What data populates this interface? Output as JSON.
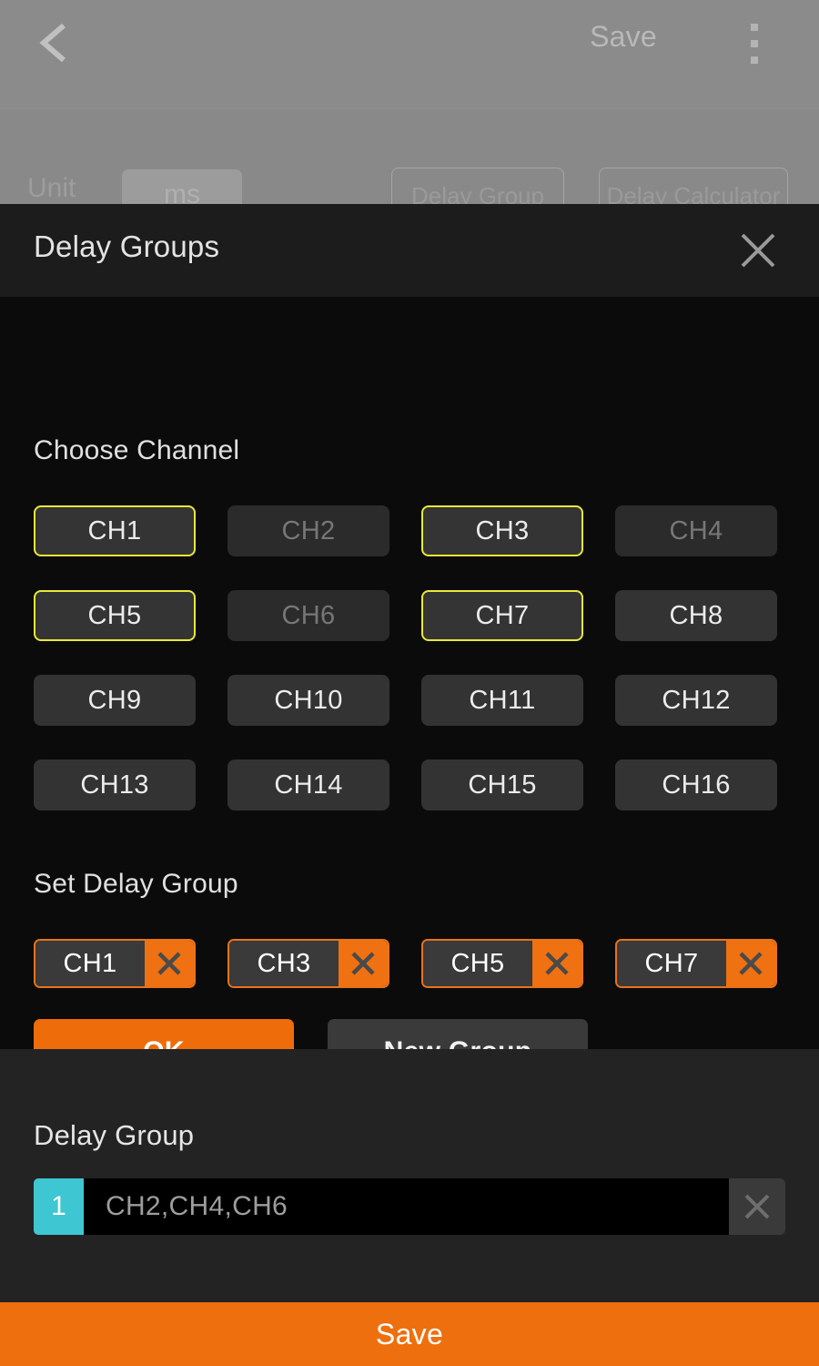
{
  "background_app": {
    "back_icon": "chevron-left-icon",
    "save_label": "Save",
    "overflow_icon": "more-vertical-icon",
    "unit_label": "Unit",
    "unit_value": "ms",
    "tabs": [
      {
        "label": "Delay Group"
      },
      {
        "label": "Delay Calculator"
      }
    ]
  },
  "modal": {
    "title": "Delay Groups",
    "close_icon": "close-icon",
    "choose_channel_label": "Choose Channel",
    "channels": [
      {
        "label": "CH1",
        "state": "selected"
      },
      {
        "label": "CH2",
        "state": "dimmed"
      },
      {
        "label": "CH3",
        "state": "selected"
      },
      {
        "label": "CH4",
        "state": "dimmed"
      },
      {
        "label": "CH5",
        "state": "selected"
      },
      {
        "label": "CH6",
        "state": "dimmed"
      },
      {
        "label": "CH7",
        "state": "selected"
      },
      {
        "label": "CH8",
        "state": "normal"
      },
      {
        "label": "CH9",
        "state": "normal"
      },
      {
        "label": "CH10",
        "state": "normal"
      },
      {
        "label": "CH11",
        "state": "normal"
      },
      {
        "label": "CH12",
        "state": "normal"
      },
      {
        "label": "CH13",
        "state": "normal"
      },
      {
        "label": "CH14",
        "state": "normal"
      },
      {
        "label": "CH15",
        "state": "normal"
      },
      {
        "label": "CH16",
        "state": "normal"
      }
    ],
    "set_delay_group_label": "Set Delay Group",
    "chips": [
      {
        "label": "CH1",
        "remove_icon": "close-icon"
      },
      {
        "label": "CH3",
        "remove_icon": "close-icon"
      },
      {
        "label": "CH5",
        "remove_icon": "close-icon"
      },
      {
        "label": "CH7",
        "remove_icon": "close-icon"
      }
    ],
    "ok_label": "OK",
    "new_group_label": "New Group"
  },
  "delay_group_panel": {
    "title": "Delay Group",
    "rows": [
      {
        "index": "1",
        "value": "CH2,CH4,CH6",
        "clear_icon": "close-icon"
      }
    ]
  },
  "bottom_bar": {
    "save_label": "Save"
  },
  "colors": {
    "accent_orange": "#ef6c0b",
    "selected_yellow": "#e8e83a",
    "badge_cyan": "#3ec6d2",
    "modal_header": "#1c1c1c",
    "modal_body": "#0b0b0b",
    "panel": "#232323"
  }
}
